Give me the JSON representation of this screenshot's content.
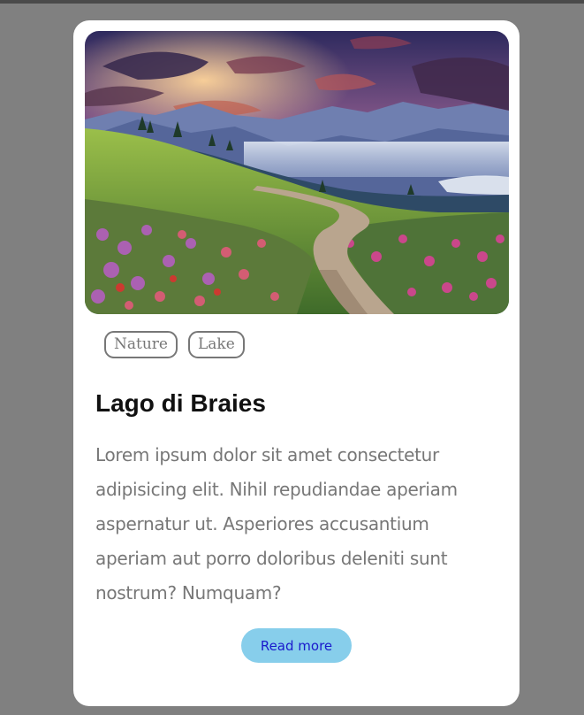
{
  "card": {
    "image_alt": "Mountain meadow with wildflowers and a winding path at sunset",
    "tags": [
      "Nature",
      "Lake"
    ],
    "title": "Lago di Braies",
    "description": "Lorem ipsum dolor sit amet consectetur adipisicing elit. Nihil repudiandae aperiam aspernatur ut. Asperiores accusantium aperiam aut porro doloribus deleniti sunt nostrum? Numquam?",
    "button_label": "Read more"
  },
  "colors": {
    "page_background": "#808080",
    "card_background": "#ffffff",
    "button_background": "#87ceeb",
    "button_text": "#1a1acc",
    "tag_border": "#777777",
    "description_text": "#777777"
  }
}
